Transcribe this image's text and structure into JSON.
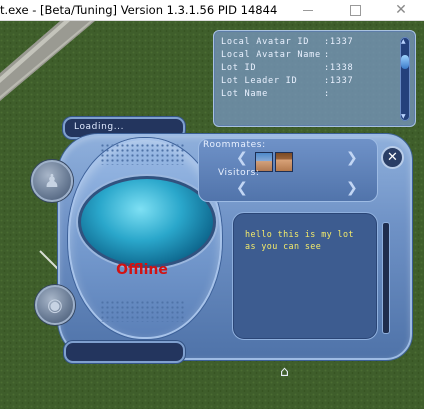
{
  "window": {
    "title": "t.exe - [Beta/Tuning] Version 1.3.1.56 PID 14844"
  },
  "debug_panel": {
    "rows": [
      {
        "label": "Local Avatar ID",
        "value": ":1337"
      },
      {
        "label": "Local Avatar Name",
        "value": ":"
      },
      {
        "label": "Lot ID",
        "value": ":1338"
      },
      {
        "label": "Lot Leader ID",
        "value": ":1337"
      },
      {
        "label": "Lot Name",
        "value": ":"
      }
    ]
  },
  "live_panel": {
    "loading_text": "Loading...",
    "status_text": "Offline",
    "roommates_label": "Roommates:",
    "visitors_label": "Visitors:",
    "chat_text": "hello this is my lot\nas you can see"
  },
  "colors": {
    "status_offline": "#d21212",
    "chat_text": "#f4eb6a",
    "panel_blue": "#6f92c6"
  },
  "icons": {
    "close": "close-icon",
    "home": "house-icon",
    "left_top": "person-silhouette-icon",
    "left_bottom": "circle-action-icon"
  }
}
